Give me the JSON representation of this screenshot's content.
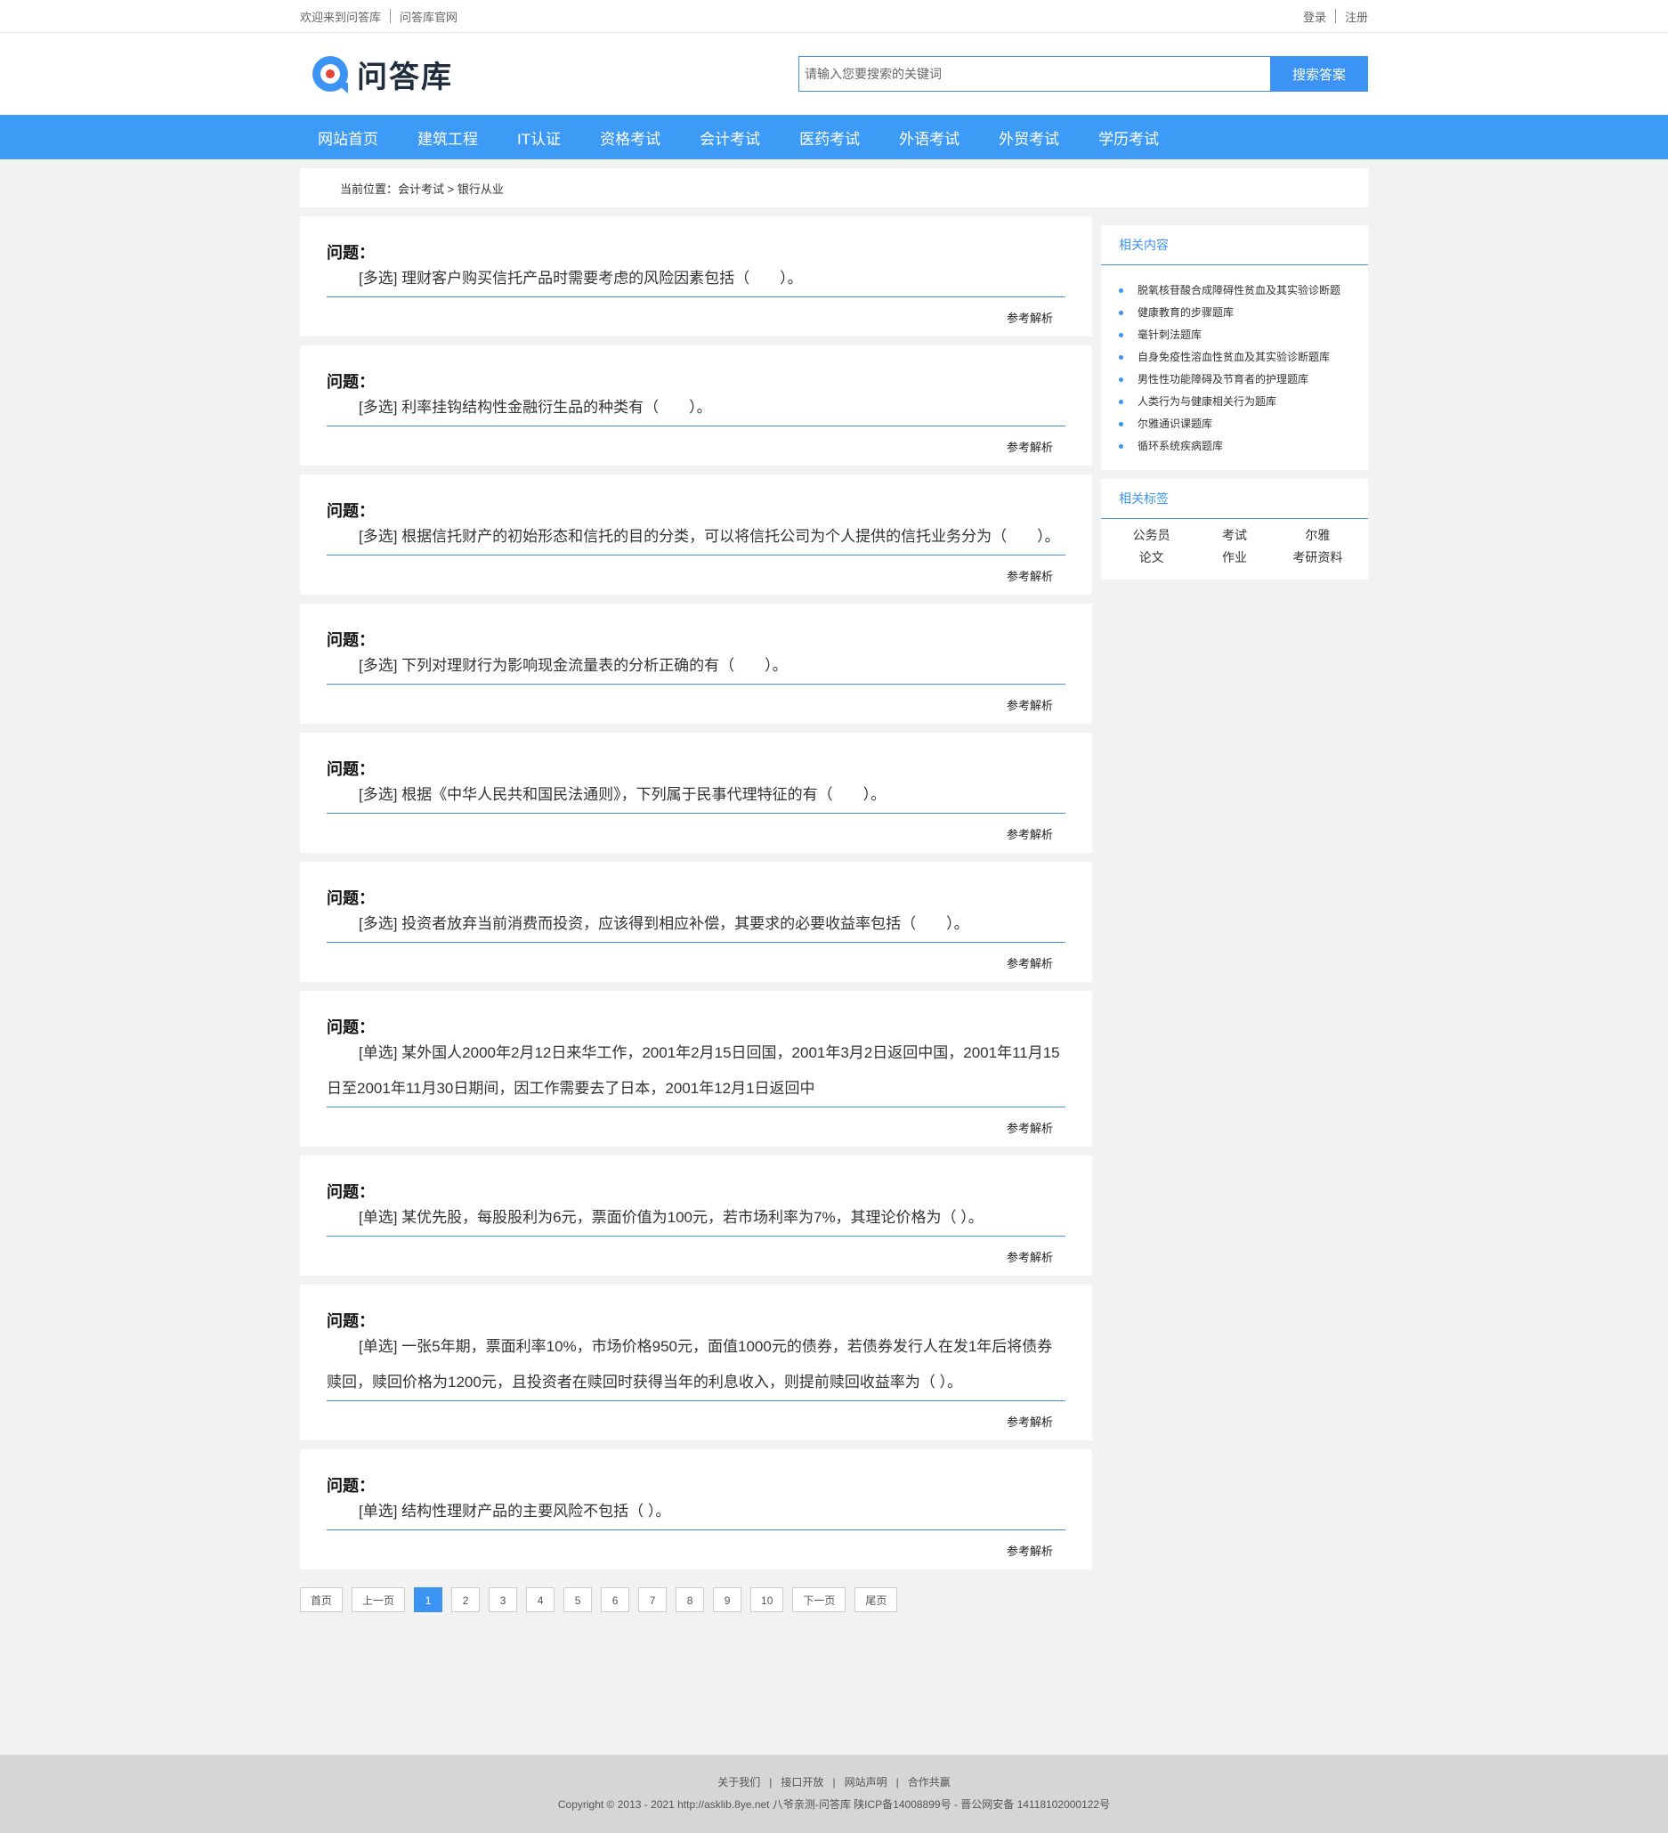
{
  "topbar": {
    "welcome": "欢迎来到问答库",
    "official": "问答库官网",
    "login": "登录",
    "register": "注册"
  },
  "header": {
    "logo_text": "问答库",
    "search_placeholder": "请输入您要搜索的关键词",
    "search_button": "搜索答案"
  },
  "nav": [
    "网站首页",
    "建筑工程",
    "IT认证",
    "资格考试",
    "会计考试",
    "医药考试",
    "外语考试",
    "外贸考试",
    "学历考试"
  ],
  "breadcrumb": "当前位置：会计考试 > 银行从业",
  "question_label": "问题：",
  "analysis_label": "参考解析",
  "questions": [
    "[多选] 理财客户购买信托产品时需要考虑的风险因素包括（　　）。",
    "[多选] 利率挂钩结构性金融衍生品的种类有（　　）。",
    "[多选] 根据信托财产的初始形态和信托的目的分类，可以将信托公司为个人提供的信托业务分为（　　）。",
    "[多选] 下列对理财行为影响现金流量表的分析正确的有（　　）。",
    "[多选] 根据《中华人民共和国民法通则》，下列属于民事代理特征的有（　　）。",
    "[多选] 投资者放弃当前消费而投资，应该得到相应补偿，其要求的必要收益率包括（　　）。",
    "[单选] 某外国人2000年2月12日来华工作，2001年2月15日回国，2001年3月2日返回中国，2001年11月15日至2001年11月30日期间，因工作需要去了日本，2001年12月1日返回中",
    "[单选] 某优先股，每股股利为6元，票面价值为100元，若市场利率为7%，其理论价格为（ ）。",
    "[单选] 一张5年期，票面利率10%，市场价格950元，面值1000元的债券，若债券发行人在发1年后将债券赎回，赎回价格为1200元，且投资者在赎回时获得当年的利息收入，则提前赎回收益率为（ ）。",
    "[单选] 结构性理财产品的主要风险不包括（ ）。"
  ],
  "pagination": [
    "首页",
    "上一页",
    "1",
    "2",
    "3",
    "4",
    "5",
    "6",
    "7",
    "8",
    "9",
    "10",
    "下一页",
    "尾页"
  ],
  "pagination_active": "1",
  "sidebar": {
    "related_title": "相关内容",
    "related": [
      "脱氧核苷酸合成障碍性贫血及其实验诊断题",
      "健康教育的步骤题库",
      "毫针刺法题库",
      "自身免疫性溶血性贫血及其实验诊断题库",
      "男性性功能障碍及节育者的护理题库",
      "人类行为与健康相关行为题库",
      "尔雅通识课题库",
      "循环系统疾病题库"
    ],
    "tags_title": "相关标签",
    "tags": [
      "公务员",
      "考试",
      "尔雅",
      "论文",
      "作业",
      "考研资料"
    ]
  },
  "footer": {
    "links": [
      "关于我们",
      "接口开放",
      "网站声明",
      "合作共赢"
    ],
    "copyright": "Copyright © 2013 - 2021 http://asklib.8ye.net  八爷亲测-问答库   陕ICP备14008899号 - 晋公网安备 14118102000122号"
  },
  "colors": {
    "accent": "#3d9bf6",
    "nav_bg": "#3d9bf6",
    "page_bg": "#f2f2f2",
    "footer_bg": "#d6d6d6"
  }
}
